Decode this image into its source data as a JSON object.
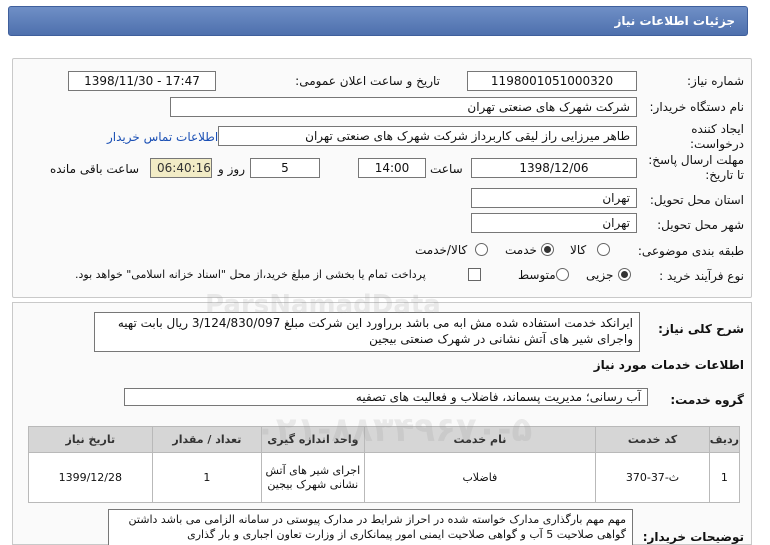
{
  "header": {
    "title": "جزئیات اطلاعات نیاز"
  },
  "fields": {
    "need_number_label": "شماره نیاز:",
    "need_number": "1198001051000320",
    "announce_label": "تاریخ و ساعت اعلان عمومی:",
    "announce_value": "1398/11/30 - 17:47",
    "buyer_label": "نام دستگاه خریدار:",
    "buyer_value": "شرکت شهرک های صنعتی تهران",
    "creator_label_line1": "ایجاد کننده",
    "creator_label_line2": "درخواست:",
    "creator_value": "طاهر  میرزایی راز لیقی کاربرداز  شرکت شهرک های صنعتی تهران",
    "contact_link": "اطلاعات تماس خریدار",
    "deadline_label_line1": "مهلت ارسال پاسخ:",
    "deadline_label_line2": "تا تاریخ:",
    "deadline_date": "1398/12/06",
    "time_label": "ساعت",
    "deadline_time": "14:00",
    "days_value": "5",
    "days_label": "روز و",
    "remaining_time": "06:40:16",
    "remaining_label": "ساعت باقی مانده",
    "province_label": "استان محل تحویل:",
    "province_value": "تهران",
    "city_label": "شهر محل تحویل:",
    "city_value": "تهران",
    "category_label": "طبقه بندی موضوعی:",
    "category_options": [
      "کالا",
      "خدمت",
      "کالا/خدمت"
    ],
    "category_selected": "خدمت",
    "process_label": "نوع فرآیند خرید :",
    "process_options": [
      "جزیی",
      "متوسط"
    ],
    "process_selected": "جزیی",
    "payment_text": "پرداخت تمام یا بخشی از مبلغ خرید،از محل \"اسناد خزانه اسلامی\" خواهد بود."
  },
  "summary": {
    "label": "شرح کلی نیاز:",
    "text": "ایرانکد خدمت استفاده شده مش ابه می باشد برراورد این شرکت مبلغ 3/124/830/097 ریال بابت  تهیه واجرای شیر های آتش نشانی در شهرک صنعتی بیجین"
  },
  "services": {
    "section_title": "اطلاعات خدمات مورد نیاز",
    "group_label": "گروه خدمت:",
    "group_value": "آب رسانی؛ مدیریت پسماند، فاضلاب و فعالیت های تصفیه",
    "columns": [
      "ردیف",
      "کد خدمت",
      "نام خدمت",
      "واحد اندازه گیری",
      "تعداد / مقدار",
      "تاریخ نیاز"
    ],
    "rows": [
      {
        "row": "1",
        "code": "ث-37-370",
        "name": "فاضلاب",
        "unit": "اجرای شیر های آتش نشانی شهرک بیجین",
        "qty": "1",
        "date": "1399/12/28"
      }
    ]
  },
  "notes": {
    "label": "توضیحات خریدار:",
    "text": "مهم مهم بارگذاری مدارک خواسته شده در احراز شرایط در مدارک پیوستی در سامانه الزامی می باشد داشتن گواهی صلاحیت 5 آب و گواهی صلاحیت ایمنی امور پیمانکاری از وزارت تعاون اجباری و بار گذاری"
  },
  "watermark": {
    "brand": "ParsNamadData",
    "phone": "۰۲۱-۸۸۳۴۹۶۷۰-۵"
  },
  "colors": {
    "header": "#5b7dbb",
    "link": "#1a4fb4",
    "remaining_bg": "#f2ecc6"
  }
}
